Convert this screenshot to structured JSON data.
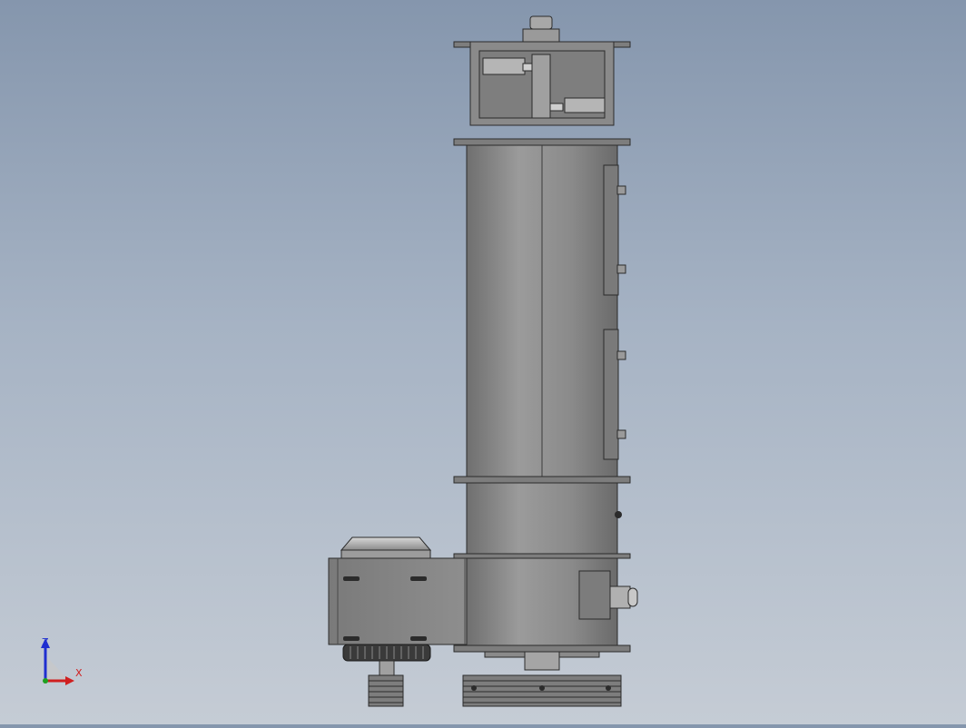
{
  "axes": {
    "z_label": "Z",
    "x_label": "X",
    "colors": {
      "z": "#1f2fd0",
      "x": "#d01f1f",
      "y": "#1fa01f"
    }
  },
  "colors": {
    "background_top": "#8596ad",
    "background_bottom": "#c5ccd5",
    "body": "#8c8c8c",
    "edge": "#2b2b2b"
  }
}
